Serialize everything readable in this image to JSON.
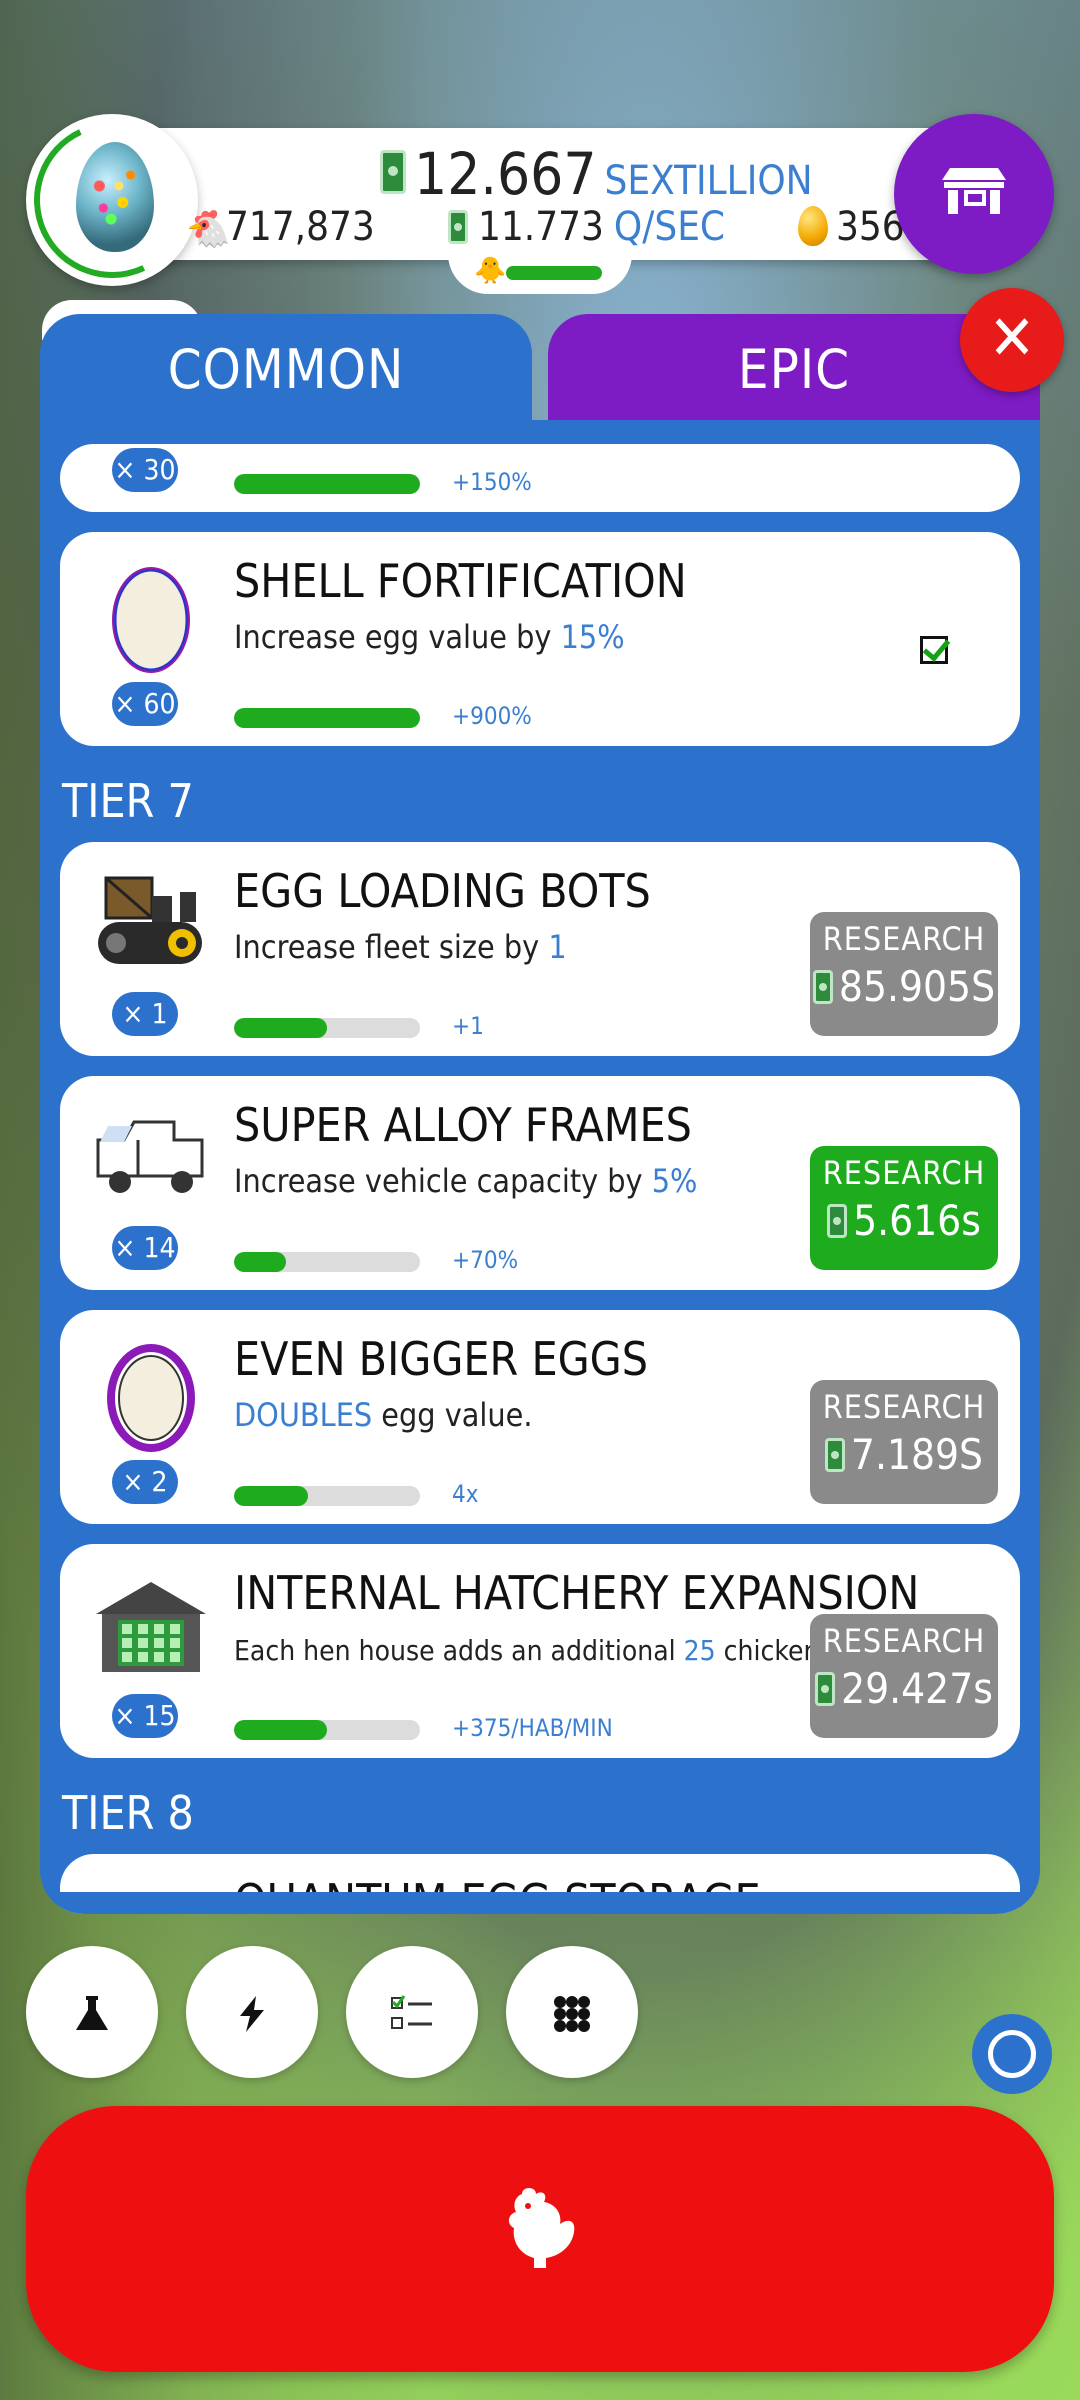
{
  "header": {
    "money_amount": "12.667",
    "money_unit": "SEXTILLION",
    "chicken_count": "717,873",
    "rate_amount": "11.773",
    "rate_unit": "Q/SEC",
    "golden_eggs": "356"
  },
  "tabs": {
    "common": "COMMON",
    "epic": "EPIC"
  },
  "research": {
    "partial_top": {
      "mult": "× 30",
      "progress": 1.0,
      "value": "+150%"
    },
    "shell": {
      "title": "SHELL FORTIFICATION",
      "desc_pre": "Increase egg value by ",
      "desc_hl": "15%",
      "desc_post": "",
      "mult": "× 60",
      "progress": 1.0,
      "value": "+900%"
    },
    "tier7": "TIER 7",
    "items": [
      {
        "title": "EGG LOADING BOTS",
        "desc_pre": "Increase fleet size by ",
        "desc_hl": "1",
        "desc_post": "",
        "mult": "× 1",
        "progress": 0.5,
        "value": "+1",
        "btn_label": "RESEARCH",
        "btn_price": "85.905S",
        "btn_state": "gray",
        "icon": "loading-bot-icon"
      },
      {
        "title": "SUPER ALLOY FRAMES",
        "desc_pre": "Increase vehicle capacity by ",
        "desc_hl": "5%",
        "desc_post": "",
        "mult": "× 14",
        "progress": 0.28,
        "value": "+70%",
        "btn_label": "RESEARCH",
        "btn_price": "5.616s",
        "btn_state": "green",
        "icon": "truck-icon"
      },
      {
        "title": "EVEN BIGGER EGGS",
        "desc_pre": "",
        "desc_hl": "DOUBLES",
        "desc_post": " egg value.",
        "mult": "× 2",
        "progress": 0.4,
        "value": "4x",
        "btn_label": "RESEARCH",
        "btn_price": "7.189S",
        "btn_state": "gray",
        "icon": "egg-purple-icon"
      },
      {
        "title": "INTERNAL HATCHERY EXPANSION",
        "desc_pre": "Each hen house adds an additional ",
        "desc_hl": "25",
        "desc_post": " chickens/min",
        "mult": "× 15",
        "progress": 0.5,
        "value": "+375/HAB/MIN",
        "btn_label": "RESEARCH",
        "btn_price": "29.427s",
        "btn_state": "gray",
        "icon": "hen-house-icon"
      }
    ],
    "tier8": "TIER 8",
    "partial_bottom_title": "QUANTUM EGG STORAGE"
  },
  "colors": {
    "panel": "#2c72cc",
    "epic": "#7d1bc4",
    "close": "#e81b1b",
    "primary": "#ee1010",
    "progress": "#1eab1e"
  }
}
